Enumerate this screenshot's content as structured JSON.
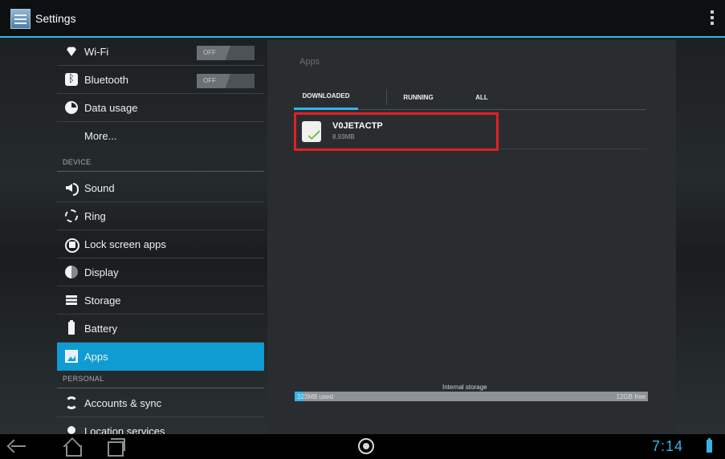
{
  "actionbar": {
    "title": "Settings"
  },
  "settings": {
    "wifi": {
      "label": "Wi-Fi",
      "toggle": "OFF"
    },
    "bluetooth": {
      "label": "Bluetooth",
      "toggle": "OFF"
    },
    "data_usage": {
      "label": "Data usage"
    },
    "more": {
      "label": "More..."
    },
    "device_header": "DEVICE",
    "sound": {
      "label": "Sound"
    },
    "ring": {
      "label": "Ring"
    },
    "lock_screen_apps": {
      "label": "Lock screen apps"
    },
    "display": {
      "label": "Display"
    },
    "storage": {
      "label": "Storage"
    },
    "battery": {
      "label": "Battery"
    },
    "apps": {
      "label": "Apps"
    },
    "personal_header": "PERSONAL",
    "accounts_sync": {
      "label": "Accounts & sync"
    },
    "location_services": {
      "label": "Location services"
    }
  },
  "apps_pane": {
    "title": "Apps",
    "tabs": [
      "DOWNLOADED",
      "RUNNING",
      "ALL"
    ],
    "selected_tab": "DOWNLOADED",
    "app_list": [
      {
        "name": "V0JETACTP",
        "size": "8.93MB"
      }
    ],
    "storage": {
      "label": "Internal storage",
      "used": "323MB used",
      "free": "12GB free",
      "used_fraction": 0.025
    }
  },
  "status": {
    "time": "7:14"
  },
  "colors": {
    "accent": "#33b5e5",
    "selected_row": "#0f9cd3",
    "highlight_box": "#e21f26"
  }
}
